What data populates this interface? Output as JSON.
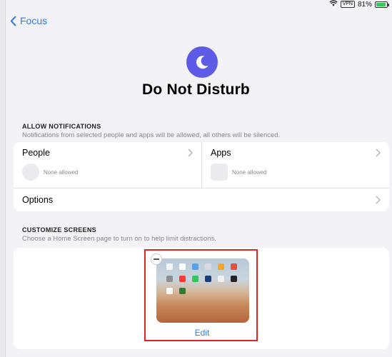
{
  "status": {
    "battery": "81%",
    "vpn": "VPN",
    "battery_level": 0.81
  },
  "nav": {
    "back_label": "Focus"
  },
  "header": {
    "title": "Do Not Disturb"
  },
  "allow_notifications": {
    "header": "ALLOW NOTIFICATIONS",
    "subtitle": "Notifications from selected people and apps will be allowed, all others will be silenced.",
    "people": {
      "label": "People",
      "status": "None allowed"
    },
    "apps": {
      "label": "Apps",
      "status": "None allowed"
    },
    "options": {
      "label": "Options"
    }
  },
  "customize_screens": {
    "header": "CUSTOMIZE SCREENS",
    "subtitle": "Choose a Home Screen page to turn on to help limit distractions.",
    "edit_label": "Edit"
  },
  "colors": {
    "accent": "#2f7cf6",
    "focus_icon": "#5e5ce6",
    "highlight": "#e02424"
  }
}
